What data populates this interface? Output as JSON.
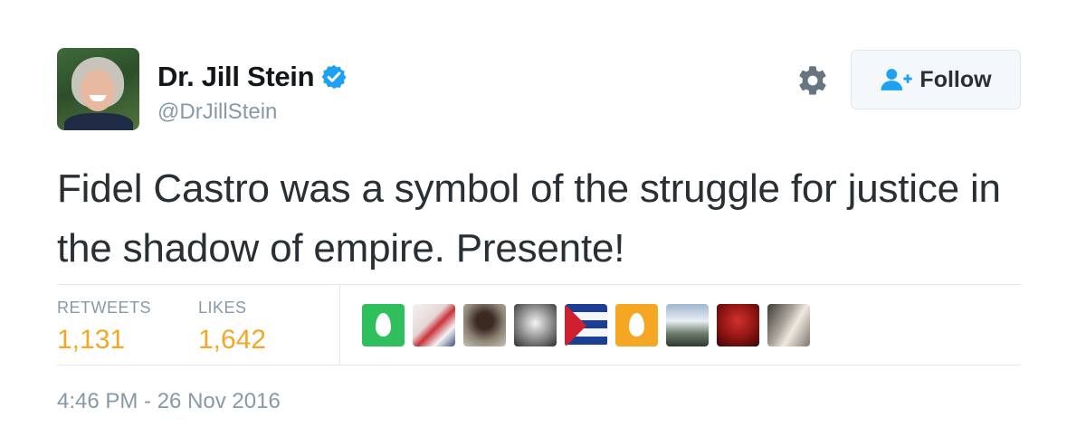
{
  "user": {
    "display_name": "Dr. Jill Stein",
    "handle": "@DrJillStein",
    "verified": true
  },
  "actions": {
    "follow_label": "Follow"
  },
  "tweet": {
    "text": "Fidel Castro was a symbol of the struggle for justice in the shadow of empire. Presente!",
    "timestamp": "4:46 PM - 26 Nov 2016"
  },
  "stats": {
    "retweets_label": "RETWEETS",
    "retweets_count": "1,131",
    "likes_label": "LIKES",
    "likes_count": "1,642"
  },
  "colors": {
    "stat_number": "#f5a623",
    "verified": "#1da1f2",
    "muted": "#8899a6"
  }
}
